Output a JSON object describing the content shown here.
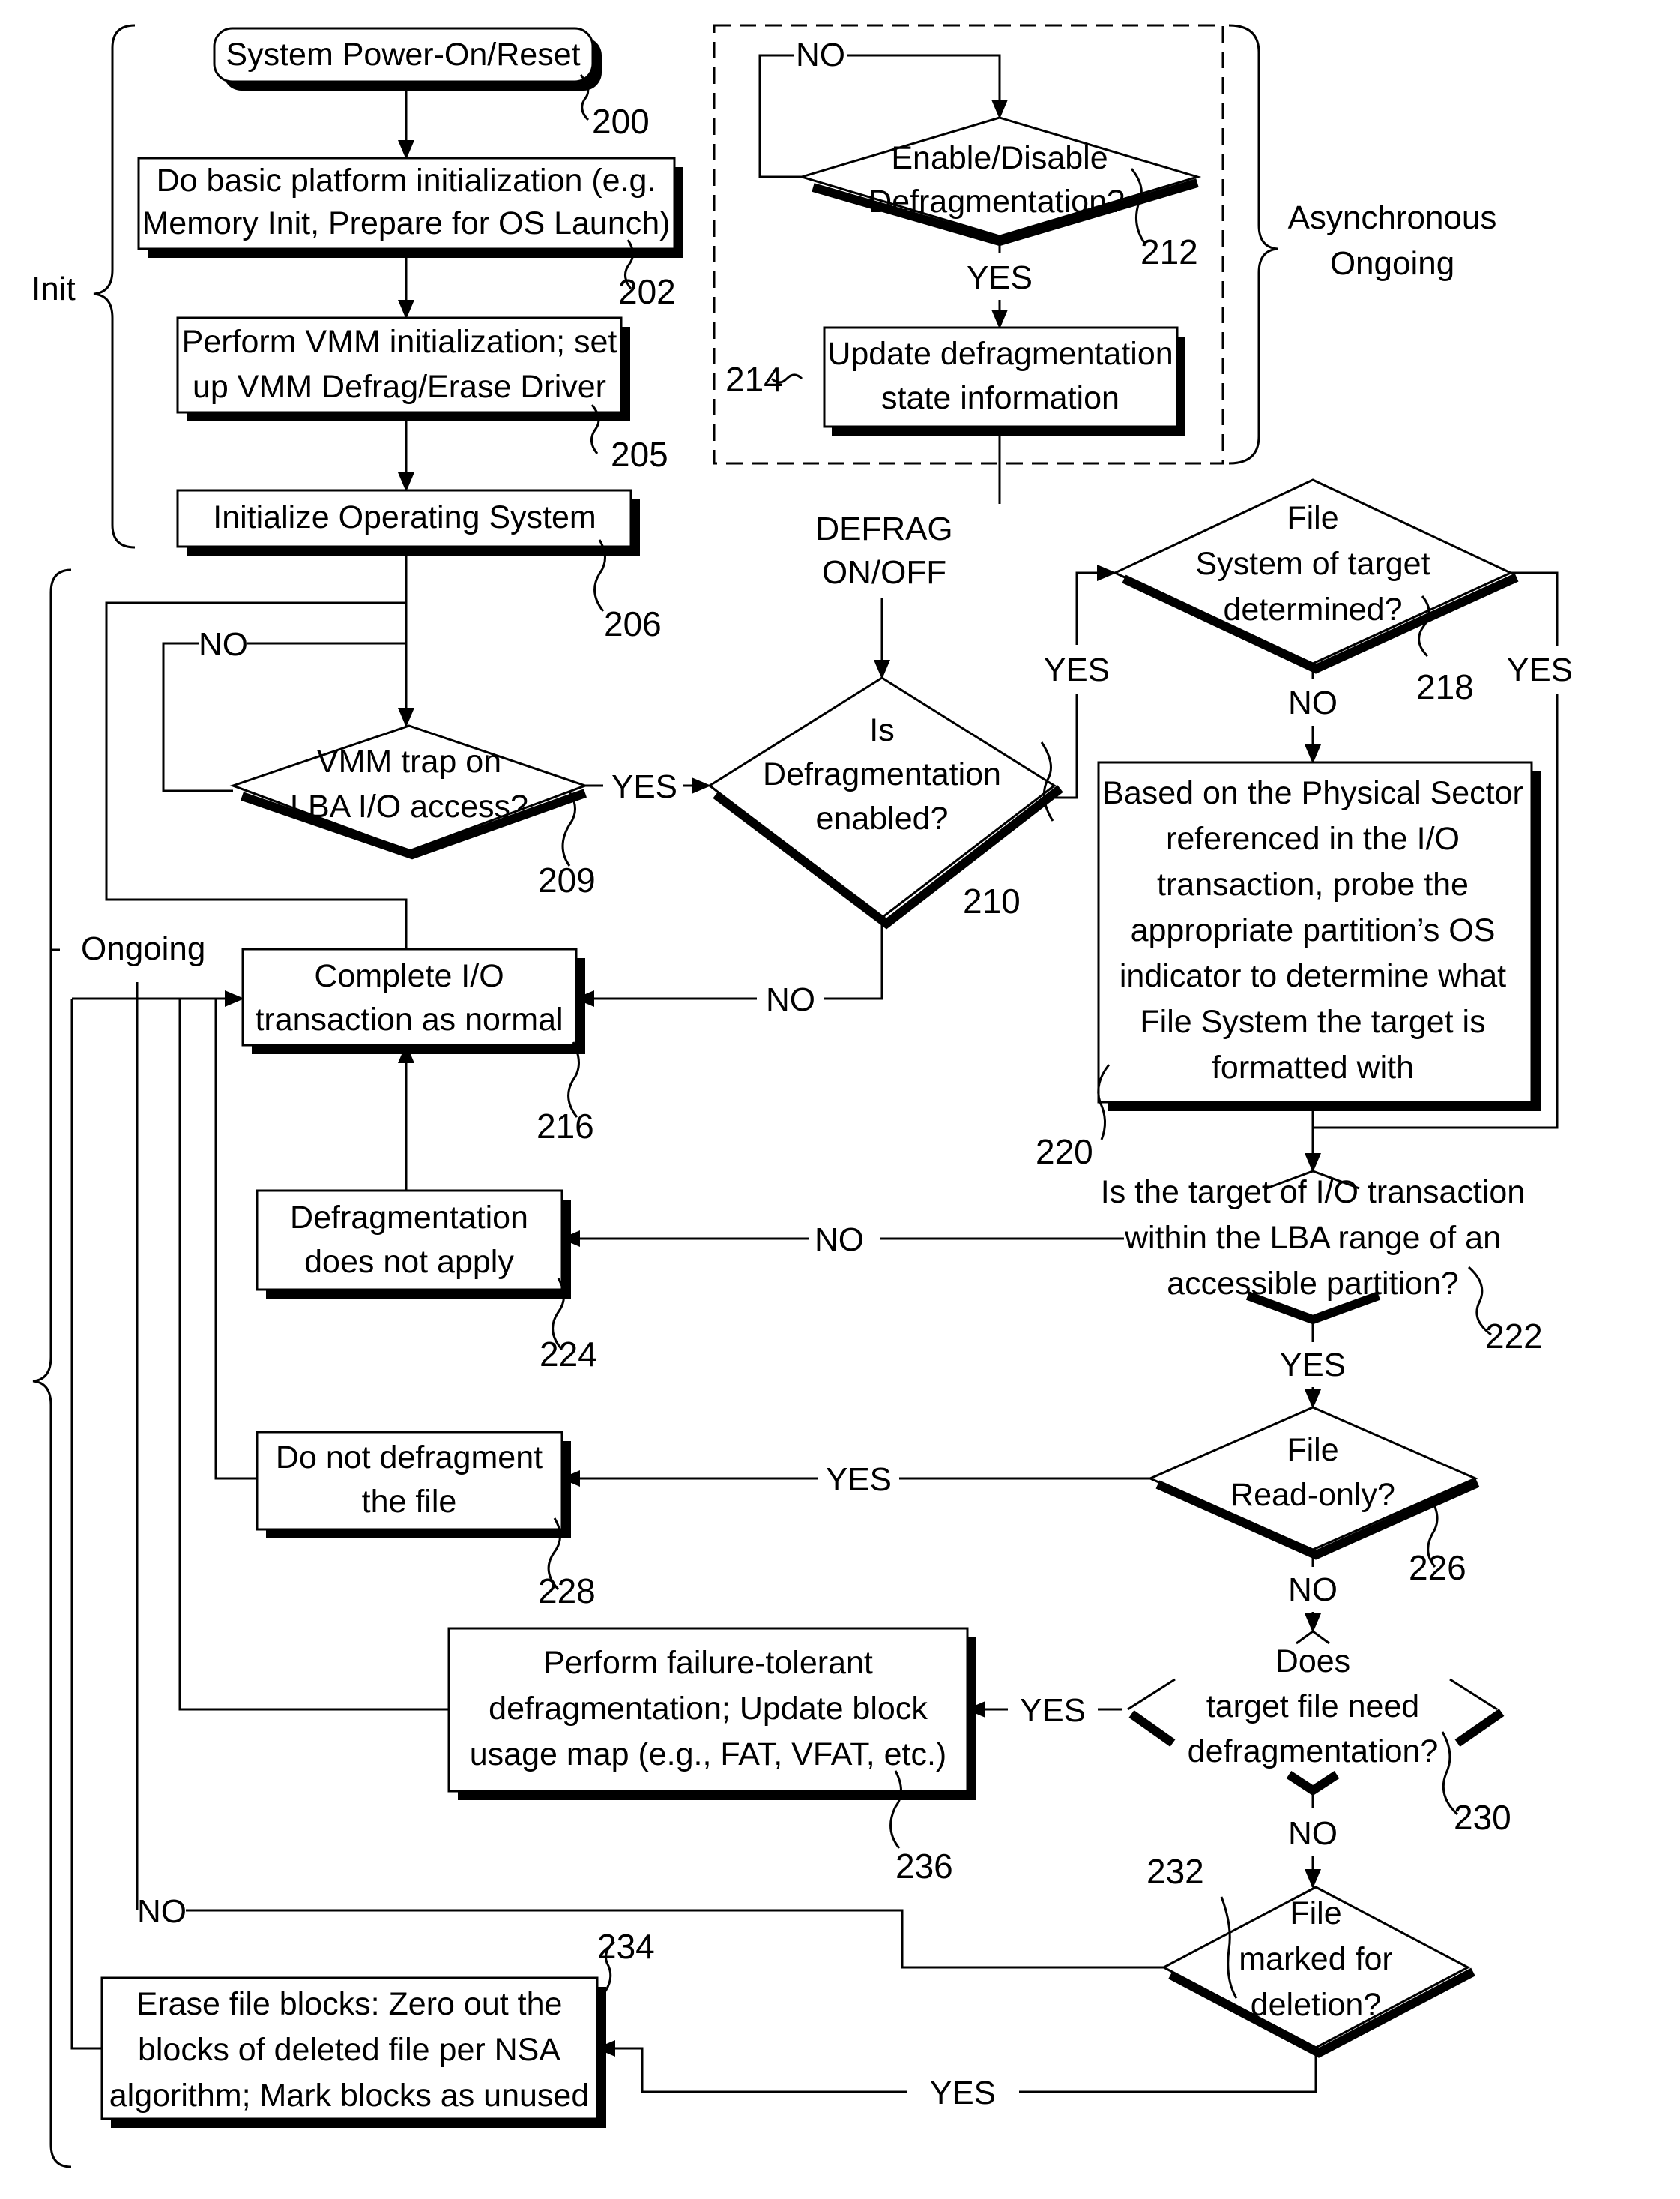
{
  "figure": {
    "brackets": {
      "init": "Init",
      "ongoing": "Ongoing",
      "async": [
        "Asynchronous",
        "Ongoing"
      ]
    },
    "nodes": {
      "n200": {
        "ref": "200",
        "lines": [
          "System Power-On/Reset"
        ]
      },
      "n202": {
        "ref": "202",
        "lines": [
          "Do basic platform initialization (e.g.",
          "Memory Init, Prepare for OS Launch)"
        ]
      },
      "n205": {
        "ref": "205",
        "lines": [
          "Perform VMM initialization; set",
          "up VMM Defrag/Erase Driver"
        ]
      },
      "n206": {
        "ref": "206",
        "lines": [
          "Initialize Operating System"
        ]
      },
      "n209": {
        "ref": "209",
        "lines": [
          "VMM trap on",
          "LBA I/O access?"
        ]
      },
      "n210": {
        "ref": "210",
        "lines": [
          "Is",
          "Defragmentation",
          "enabled?"
        ]
      },
      "n212": {
        "ref": "212",
        "lines": [
          "Enable/Disable",
          "Defragmentation?"
        ]
      },
      "n214": {
        "ref": "214",
        "lines": [
          "Update defragmentation",
          "state information"
        ]
      },
      "n216": {
        "ref": "216",
        "lines": [
          "Complete I/O",
          "transaction as normal"
        ]
      },
      "n218": {
        "ref": "218",
        "lines": [
          "File",
          "System of target",
          "determined?"
        ]
      },
      "n220": {
        "ref": "220",
        "lines": [
          "Based on the Physical Sector",
          "referenced in the I/O",
          "transaction, probe the",
          "appropriate partition’s OS",
          "indicator to determine what",
          "File System the target is",
          "formatted with"
        ]
      },
      "n222": {
        "ref": "222",
        "lines": [
          "Is the target of I/O transaction",
          "within the LBA range of an",
          "accessible partition?"
        ]
      },
      "n224": {
        "ref": "224",
        "lines": [
          "Defragmentation",
          "does not apply"
        ]
      },
      "n226": {
        "ref": "226",
        "lines": [
          "File",
          "Read-only?"
        ]
      },
      "n228": {
        "ref": "228",
        "lines": [
          "Do not defragment",
          "the file"
        ]
      },
      "n230": {
        "ref": "230",
        "lines": [
          "Does",
          "target file need",
          "defragmentation?"
        ]
      },
      "n232": {
        "ref": "232",
        "lines": [
          "File",
          "marked for",
          "deletion?"
        ]
      },
      "n234": {
        "ref": "234",
        "lines": [
          "Erase file blocks:  Zero out the",
          "blocks of deleted file per NSA",
          "algorithm; Mark blocks as unused"
        ]
      },
      "n236": {
        "ref": "236",
        "lines": [
          "Perform failure-tolerant",
          "defragmentation; Update block",
          "usage map (e.g., FAT, VFAT, etc.)"
        ]
      }
    },
    "edge_labels": {
      "e212_no": "NO",
      "e212_yes": "YES",
      "defrag_signal": [
        "DEFRAG",
        "ON/OFF"
      ],
      "e209_no": "NO",
      "e209_yes": "YES",
      "e210_yes": "YES",
      "e210_no": "NO",
      "e218_no": "NO",
      "e218_yes": "YES",
      "e222_no": "NO",
      "e222_yes": "YES",
      "e226_yes": "YES",
      "e226_no": "NO",
      "e230_yes": "YES",
      "e230_no": "NO",
      "e232_no": "NO",
      "e232_yes": "YES"
    }
  }
}
